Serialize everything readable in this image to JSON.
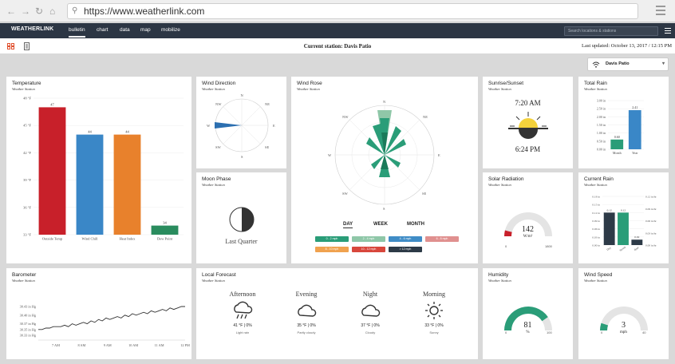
{
  "browser": {
    "url": "https://www.weatherlink.com"
  },
  "nav": {
    "brand": "WEATHERLINK",
    "links": [
      "bulletin",
      "chart",
      "data",
      "map",
      "mobilize"
    ],
    "search_placeholder": "Search locations & stations"
  },
  "subbar": {
    "station": "Current station: Davis Patio",
    "updated": "Last updated: October 13, 2017 / 12:15 PM"
  },
  "selector": {
    "label": "Davis Patio"
  },
  "cards": {
    "temperature": {
      "title": "Temperature",
      "subtitle": "Weather Station"
    },
    "wind_direction": {
      "title": "Wind Direction",
      "subtitle": "Weather Station",
      "compass": [
        "NW",
        "N",
        "NE",
        "W",
        "E",
        "SW",
        "S",
        "SE"
      ]
    },
    "wind_rose": {
      "title": "Wind Rose",
      "subtitle": "Weather Station",
      "compass": [
        "N",
        "NW",
        "NE",
        "W",
        "E",
        "SW",
        "SE",
        "S"
      ],
      "tabs": [
        "DAY",
        "WEEK",
        "MONTH"
      ],
      "legend": [
        "0 - 2 mph",
        "2 - 4 mph",
        "4 - 6 mph",
        "6 - 8 mph",
        "8 - 10 mph",
        "10 - 12 mph",
        "> 12 mph"
      ],
      "legend_colors": [
        "#2a9d78",
        "#8fc7a8",
        "#3f8cc6",
        "#e0908f",
        "#f0a24f",
        "#d8473c",
        "#2d3a47"
      ]
    },
    "sun": {
      "title": "Sunrise/Sunset",
      "subtitle": "Weather Station",
      "sunrise": "7:20 AM",
      "sunset": "6:24 PM"
    },
    "total_rain": {
      "title": "Total Rain",
      "subtitle": "Weather Station"
    },
    "moon": {
      "title": "Moon Phase",
      "subtitle": "Weather Station",
      "phase": "Last Quarter"
    },
    "solar": {
      "title": "Solar Radiation",
      "subtitle": "Weather Station",
      "value": "142",
      "unit": "W/m²",
      "min": "0",
      "max": "1800",
      "level": 0.08
    },
    "current_rain": {
      "title": "Current Rain",
      "subtitle": "Weather Station"
    },
    "barometer": {
      "title": "Barometer",
      "subtitle": "Weather Station"
    },
    "forecast": {
      "title": "Local Forecast",
      "subtitle": "Weather Station",
      "periods": [
        {
          "time": "Afternoon",
          "temp": "41 °F | 0%",
          "cond": "Light rain",
          "icon": "rain-cloud-icon"
        },
        {
          "time": "Evening",
          "temp": "35 °F | 0%",
          "cond": "Partly cloudy",
          "icon": "cloud-icon"
        },
        {
          "time": "Night",
          "temp": "37 °F | 0%",
          "cond": "Cloudy",
          "icon": "cloud-icon"
        },
        {
          "time": "Morning",
          "temp": "33 °F | 0%",
          "cond": "Sunny",
          "icon": "sun-icon"
        }
      ]
    },
    "humidity": {
      "title": "Humidity",
      "subtitle": "Weather Station",
      "value": "81",
      "unit": "%",
      "min": "0",
      "max": "100",
      "level": 0.81
    },
    "wind_speed": {
      "title": "Wind Speed",
      "subtitle": "Weather Station",
      "value": "3",
      "unit": "mph",
      "min": "0",
      "max": "40",
      "level": 0.1
    }
  },
  "chart_data": [
    {
      "type": "bar",
      "title": "Temperature",
      "categories": [
        "Outside Temp",
        "Wind Chill",
        "Heat Index",
        "Dew Point"
      ],
      "values": [
        47,
        44,
        44,
        34
      ],
      "ylim": [
        33,
        48
      ],
      "yticks": [
        "33 °F",
        "36 °F",
        "39 °F",
        "42 °F",
        "45 °F",
        "48 °F"
      ],
      "colors": [
        "#c8202a",
        "#3a87c7",
        "#e8812c",
        "#2a8c5e"
      ]
    },
    {
      "type": "bar",
      "title": "Total Rain",
      "categories": [
        "Month",
        "Year"
      ],
      "values": [
        0.6,
        2.41
      ],
      "value_labels": [
        "0.60",
        "2.41"
      ],
      "ylim": [
        0,
        3
      ],
      "yticks": [
        "0.00 in",
        "0.50 in",
        "1.00 in",
        "1.50 in",
        "2.00 in",
        "2.50 in",
        "3.00 in"
      ],
      "colors": [
        "#2a9d78",
        "#3a87c7"
      ]
    },
    {
      "type": "bar",
      "title": "Current Rain",
      "categories": [
        "Day",
        "Storm",
        "Rate"
      ],
      "values": [
        0.12,
        0.12,
        0.02
      ],
      "value_labels": [
        "0.12",
        "0.12",
        "0.02"
      ],
      "ylim": [
        0,
        0.18
      ],
      "yticks": [
        "0.00 in",
        "0.03 in",
        "0.06 in",
        "0.09 in",
        "0.12 in",
        "0.15 in",
        "0.18 in"
      ],
      "yticks_right": [
        "0.00 in/hr",
        "0.03 in/hr",
        "0.06 in/hr",
        "0.09 in/hr",
        "0.12 in/hr"
      ],
      "colors": [
        "#2d3a47",
        "#2a9d78",
        "#2d3a47"
      ]
    },
    {
      "type": "line",
      "title": "Barometer",
      "x_ticks": [
        "7 AM",
        "8 AM",
        "9 AM",
        "10 AM",
        "11 AM",
        "12 PM"
      ],
      "yticks": [
        "30.33 in Hg",
        "30.35 in Hg",
        "30.37 in Hg",
        "30.40 in Hg",
        "30.43 in Hg"
      ],
      "values": [
        30.35,
        30.35,
        30.355,
        30.355,
        30.36,
        30.36,
        30.36,
        30.365,
        30.36,
        30.37,
        30.365,
        30.37,
        30.375,
        30.37,
        30.38,
        30.375,
        30.385,
        30.38,
        30.39,
        30.385,
        30.39,
        30.395,
        30.39,
        30.4,
        30.395,
        30.405,
        30.4,
        30.405,
        30.41,
        30.405,
        30.415,
        30.41,
        30.415,
        30.42,
        30.415,
        30.425,
        30.42,
        30.425,
        30.43,
        30.43
      ]
    }
  ]
}
